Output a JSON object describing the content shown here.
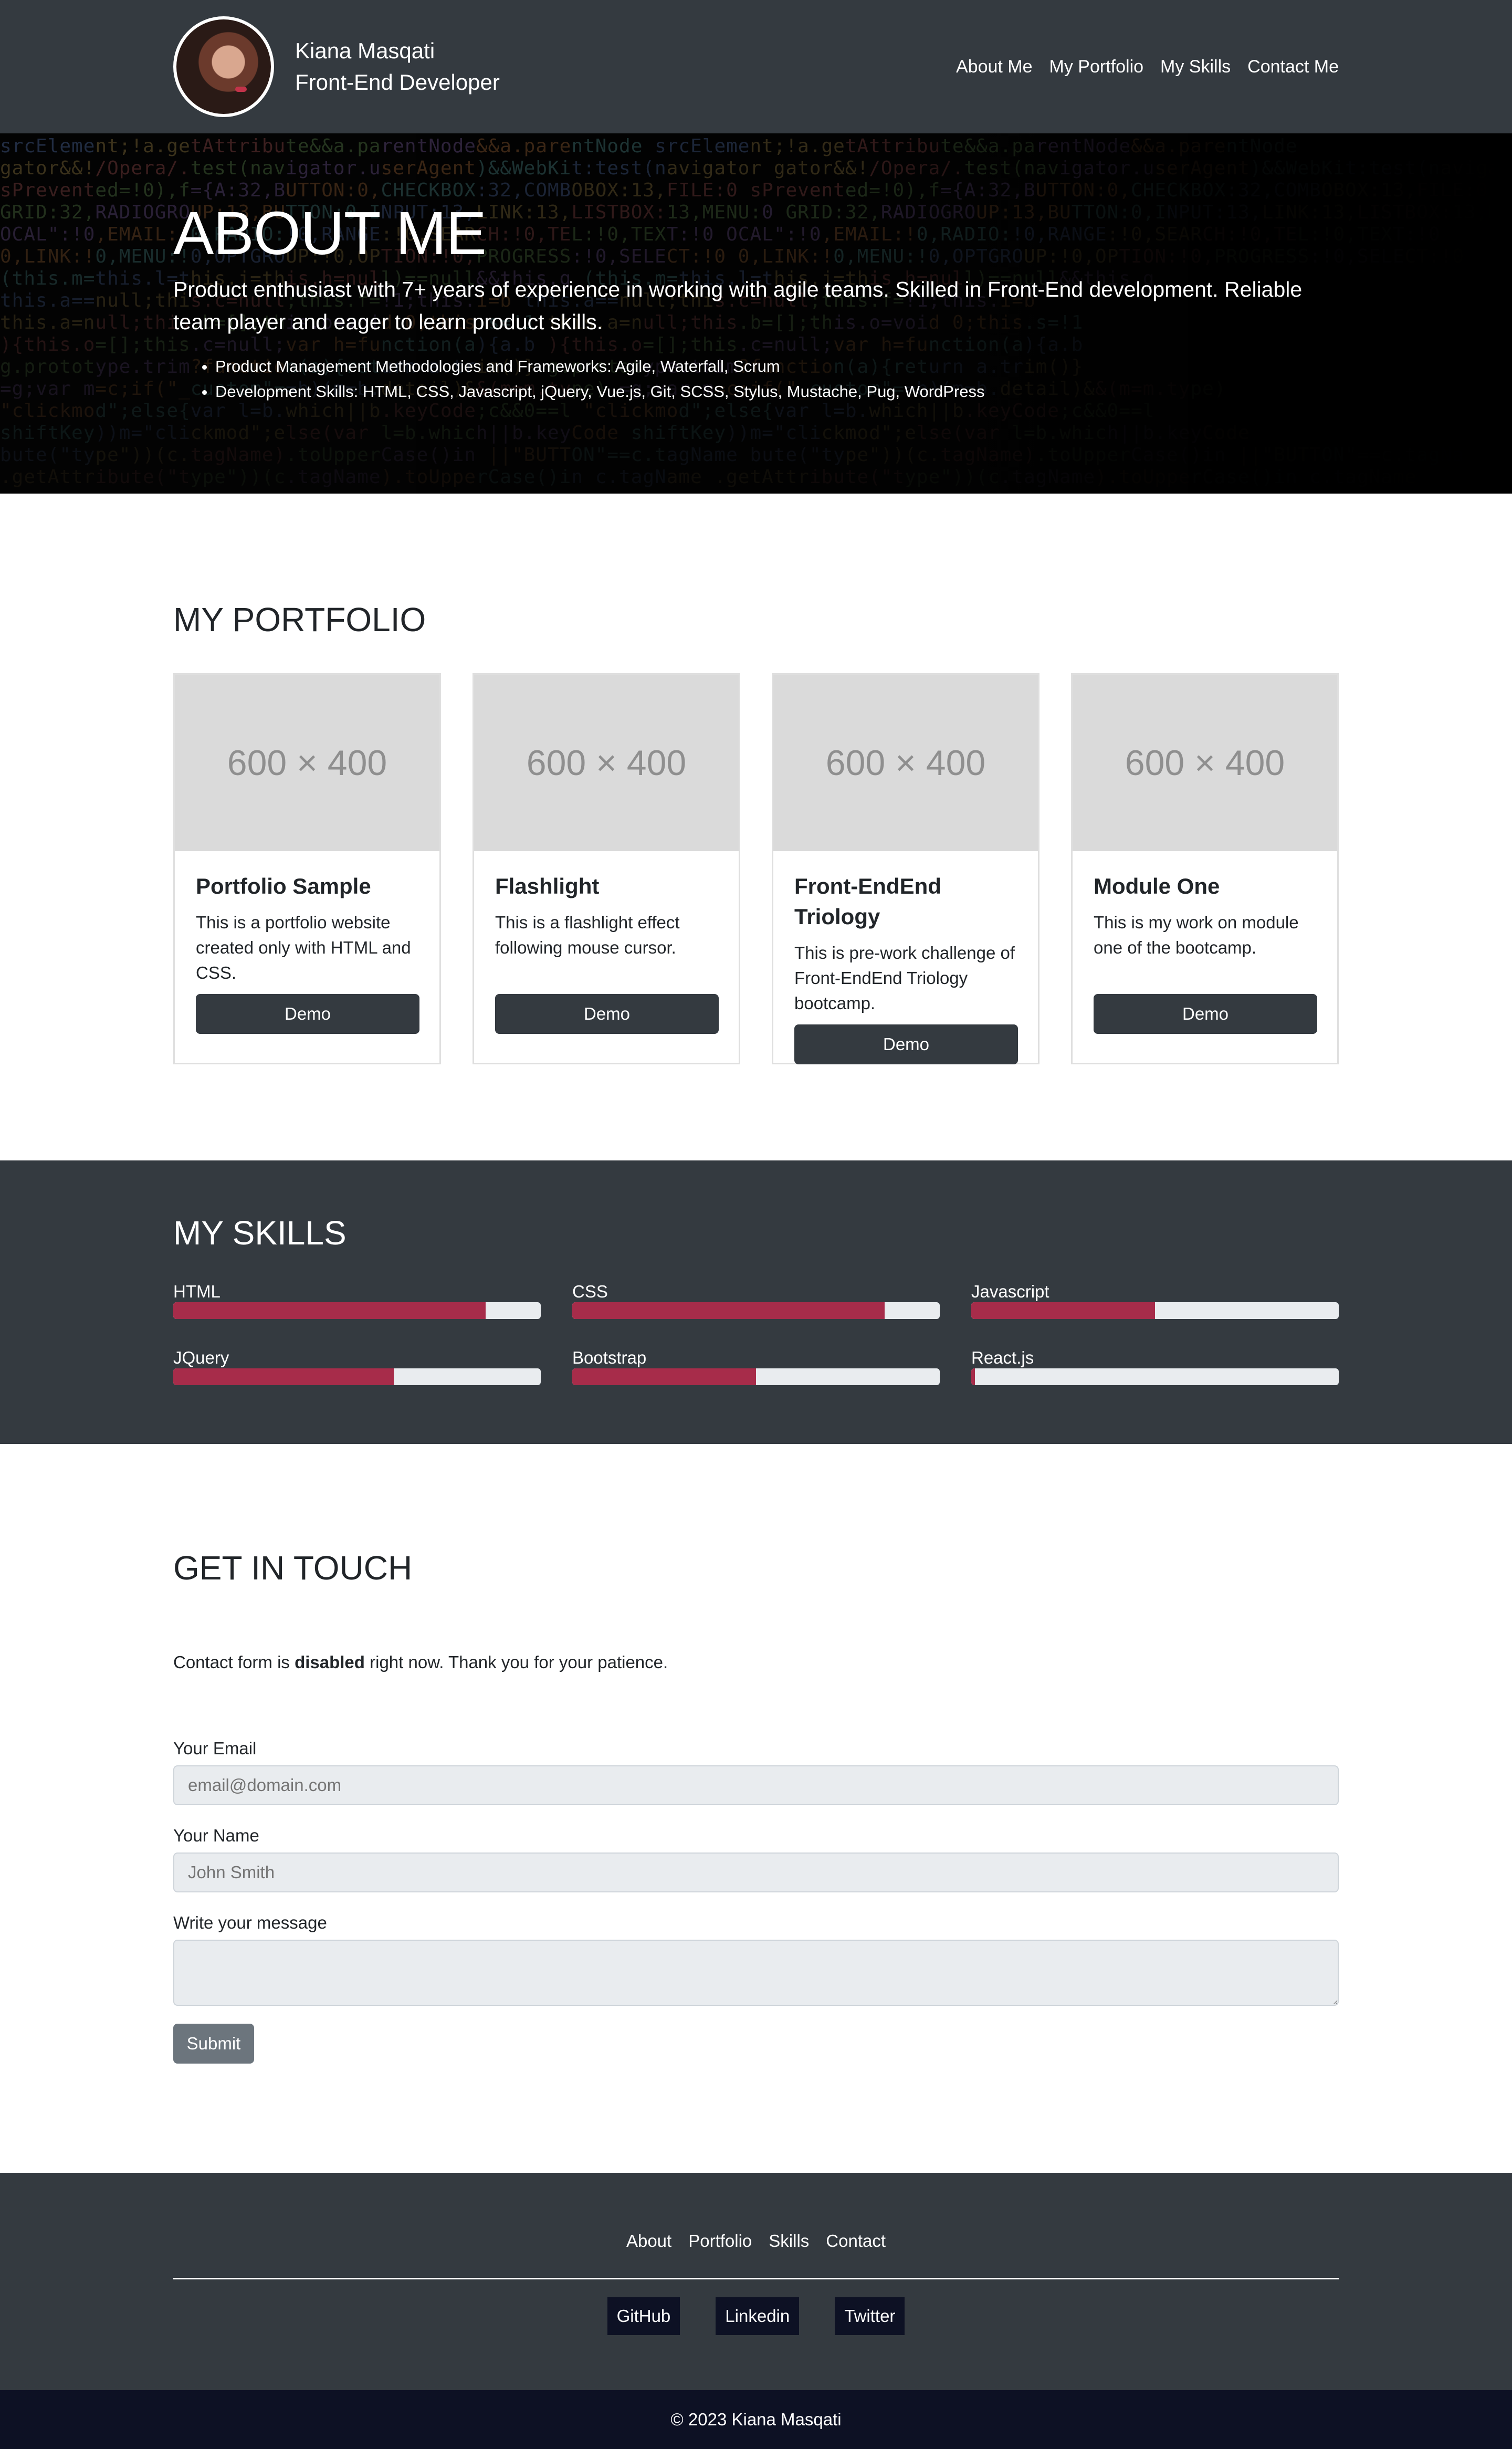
{
  "header": {
    "name": "Kiana Masqati",
    "role": "Front-End Developer",
    "nav": [
      "About Me",
      "My Portfolio",
      "My Skills",
      "Contact Me"
    ]
  },
  "about": {
    "title": "ABOUT ME",
    "lead": "Product enthusiast with 7+ years of experience in working with agile teams. Skilled in Front-End development. Reliable team player and eager to learn product skills.",
    "bullets": [
      "Product Management Methodologies and Frameworks: Agile, Waterfall, Scrum",
      "Development Skills: HTML, CSS, Javascript, jQuery, Vue.js, Git, SCSS, Stylus, Mustache, Pug, WordPress"
    ],
    "background_code": [
      "srcElement;!a.getAttribute&&a.parentNode&&a.parentNode",
      "gator&&!/Opera/.test(navigator.userAgent)&&WebKit:test(navigator",
      "sPrevented=!0),f={A:32,BUTTON:0,CHECKBOX:32,COMBOBOX:13,FILE:0",
      "GRID:32,RADIOGROUP:13,BUTTON:0,INPUT:13,LINK:13,LISTBOX:13,MENU:0",
      "OCAL\":!0,EMAIL:!0,RADIO:!0,RANGE:!0,SEARCH:!0,TEL:!0,TEXT:!0",
      "0,LINK:!0,MENU:!0,OPTGROUP:!0,OPTION:!0,PROGRESS:!0,SELECT:!0",
      "(this.m=this.l=this.j=this.h=null)==null&&this.g",
      "this.a==null;this.c=null;this.f=!1;this.i=b",
      "this.a=null;this.b=[];this.o=void 0;this.s=!1",
      "){this.o=[];this.c=null;var h=function(a){a.b",
      "g.prototype.trim?function(a){return a.trim()}",
      "=g;var m=c;if(\"_custom\"==b)(m=b.detail)&&(m=m.type)",
      "\"clickmod\";else{var l=b.which||b.keyCode;c&&0==l",
      "shiftKey))m=\"clickmod\";else(var l=b.which||b.keyCode",
      "bute(\"type\"))(c.tagName).toUpperCase()in ||\"BUTTON\"==c.tagName",
      ".getAttribute(\"type\"))(c.tagName).toUpperCase()in c.tagName"
    ]
  },
  "portfolio": {
    "title": "MY PORTFOLIO",
    "placeholder": "600 × 400",
    "button_label": "Demo",
    "cards": [
      {
        "title": "Portfolio Sample",
        "text": "This is a portfolio website created only with HTML and CSS."
      },
      {
        "title": "Flashlight",
        "text": "This is a flashlight effect following mouse cursor."
      },
      {
        "title": "Front-EndEnd Triology",
        "text": "This is pre-work challenge of Front-EndEnd Triology bootcamp."
      },
      {
        "title": "Module One",
        "text": "This is my work on module one of the bootcamp."
      }
    ]
  },
  "skills": {
    "title": "MY SKILLS",
    "items": [
      {
        "name": "HTML",
        "level": 85
      },
      {
        "name": "CSS",
        "level": 85
      },
      {
        "name": "Javascript",
        "level": 50
      },
      {
        "name": "JQuery",
        "level": 60
      },
      {
        "name": "Bootstrap",
        "level": 50
      },
      {
        "name": "React.js",
        "level": 1
      }
    ],
    "bar_color": "#a72c4a"
  },
  "contact": {
    "title": "GET IN TOUCH",
    "notice_prefix": "Contact form is ",
    "notice_bold": "disabled",
    "notice_suffix": " right now. Thank you for your patience.",
    "email_label": "Your Email",
    "email_placeholder": "email@domain.com",
    "name_label": "Your Name",
    "name_placeholder": "John Smith",
    "message_label": "Write your message",
    "submit_label": "Submit"
  },
  "footer": {
    "nav": [
      "About",
      "Portfolio",
      "Skills",
      "Contact"
    ],
    "social": [
      "GitHub",
      "Linkedin",
      "Twitter"
    ],
    "copyright": "© 2023 Kiana Masqati"
  }
}
